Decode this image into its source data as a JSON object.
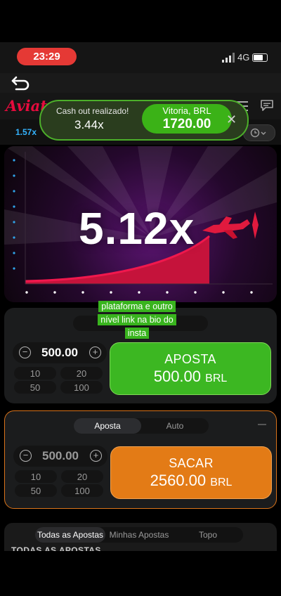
{
  "status_bar": {
    "time": "23:29",
    "network": "4G"
  },
  "header": {
    "logo": "Aviator"
  },
  "toast": {
    "caption": "Cash out realizado!",
    "multiplier": "3.44x",
    "win_label": "Vitoria, BRL",
    "win_amount": "1720.00"
  },
  "history": {
    "first": "1.57x"
  },
  "game": {
    "multiplier": "5.12x"
  },
  "overlay": {
    "text": "plataforma e outro nível link na bio do insta"
  },
  "bet1": {
    "stepper_value": "500.00",
    "quick": [
      "10",
      "20",
      "50",
      "100"
    ],
    "button_title": "APOSTA",
    "button_amount": "500.00",
    "currency": "BRL"
  },
  "bet2": {
    "tabs": [
      "Aposta",
      "Auto"
    ],
    "stepper_value": "500.00",
    "quick": [
      "10",
      "20",
      "50",
      "100"
    ],
    "button_title": "SACAR",
    "button_amount": "2560.00",
    "currency": "BRL"
  },
  "bottom": {
    "tabs": [
      "Todas as Apostas",
      "Minhas Apostas",
      "Topo"
    ],
    "heading": "TODAS AS APOSTAS"
  },
  "colors": {
    "accent_red": "#e60b3d",
    "aposta_green": "#3cb722",
    "sacar_orange": "#e37b16",
    "history_blue": "#34b4ff"
  }
}
